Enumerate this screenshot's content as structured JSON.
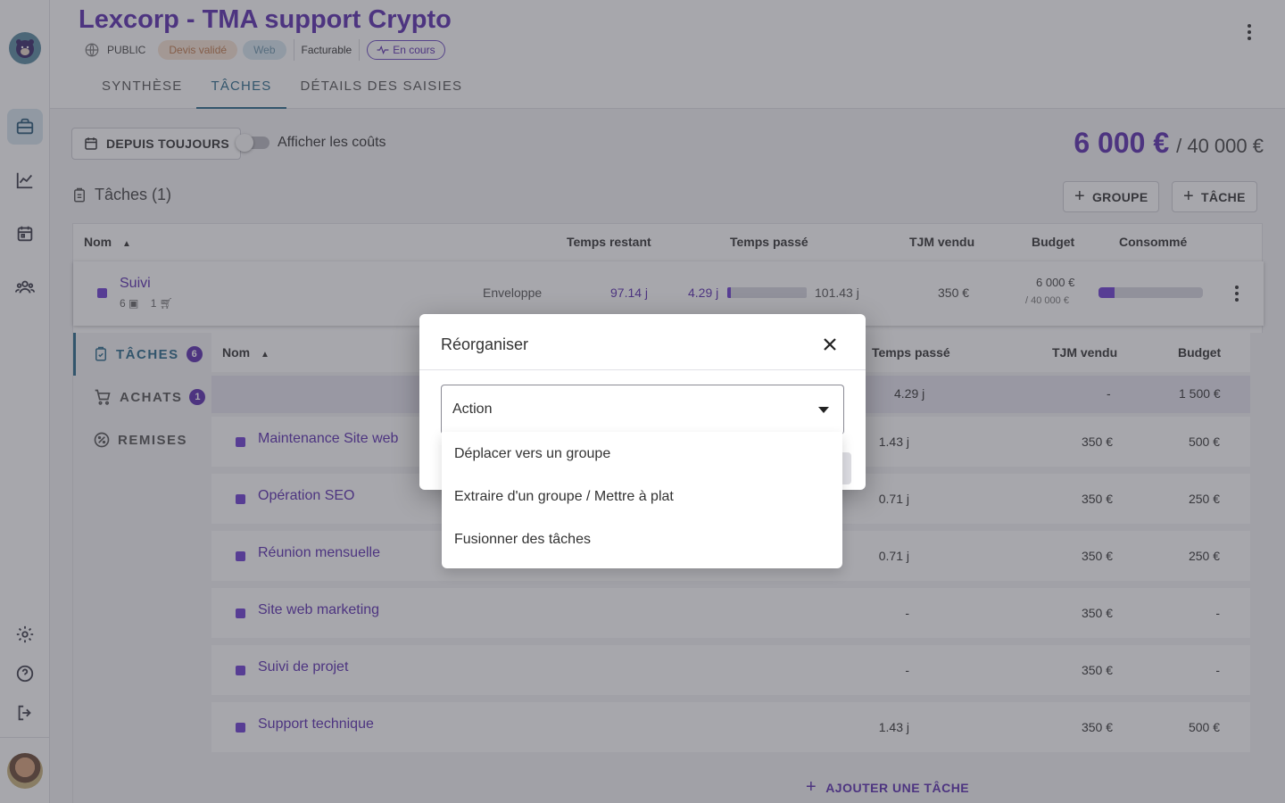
{
  "header": {
    "title": "Lexcorp - TMA support Crypto",
    "visibility": "PUBLIC",
    "chips": {
      "devis": "Devis validé",
      "web": "Web",
      "billable": "Facturable",
      "status": "En cours"
    },
    "tabs": [
      "SYNTHÈSE",
      "TÂCHES",
      "DÉTAILS DES SAISIES"
    ]
  },
  "toolbar": {
    "period_button": "DEPUIS TOUJOURS",
    "toggle_label": "Afficher les coûts",
    "amount_spent": "6 000 €",
    "amount_total": "/ 40 000 €"
  },
  "section": {
    "title": "Tâches (1)",
    "add_group": "GROUPE",
    "add_task": "TÂCHE"
  },
  "table": {
    "columns": {
      "name": "Nom",
      "remaining": "Temps restant",
      "spent": "Temps passé",
      "tjm": "TJM vendu",
      "budget": "Budget",
      "consumed": "Consommé"
    },
    "group": {
      "name": "Suivi",
      "tasks_count": "6",
      "purchases_count": "1",
      "type": "Enveloppe",
      "remaining": "97.14 j",
      "spent": "4.29 j",
      "spent_progress": 0.04,
      "estimated": "101.43 j",
      "tjm": "350 €",
      "budget": "6 000 €",
      "budget_total": "/ 40 000 €",
      "consumed_progress": 0.15
    }
  },
  "subnav": {
    "tasks": "TÂCHES",
    "tasks_badge": "6",
    "purchases": "ACHATS",
    "purchases_badge": "1",
    "discounts": "REMISES"
  },
  "subtable": {
    "columns": {
      "name": "Nom",
      "spent": "Temps passé",
      "tjm": "TJM vendu",
      "budget": "Budget"
    },
    "total": {
      "spent": "4.29 j",
      "tjm": "-",
      "budget": "1 500 €"
    },
    "rows": [
      {
        "name": "Maintenance Site web",
        "spent": "1.43 j",
        "tjm": "350 €",
        "budget": "500 €"
      },
      {
        "name": "Opération SEO",
        "spent": "0.71 j",
        "tjm": "350 €",
        "budget": "250 €"
      },
      {
        "name": "Réunion mensuelle",
        "spent": "0.71 j",
        "tjm": "350 €",
        "budget": "250 €"
      },
      {
        "name": "Site web marketing",
        "spent": "-",
        "tjm": "350 €",
        "budget": "-"
      },
      {
        "name": "Suivi de projet",
        "spent": "-",
        "tjm": "350 €",
        "budget": "-"
      },
      {
        "name": "Support technique",
        "spent": "1.43 j",
        "tjm": "350 €",
        "budget": "500 €"
      }
    ],
    "add_task": "AJOUTER UNE TÂCHE"
  },
  "dialog": {
    "title": "Réorganiser",
    "select_value": "Action",
    "options": [
      "Déplacer vers un groupe",
      "Extraire d'un groupe / Mettre à plat",
      "Fusionner des tâches"
    ]
  },
  "colors": {
    "brand": "#5b2fb0",
    "accent": "#2b6a8a"
  }
}
